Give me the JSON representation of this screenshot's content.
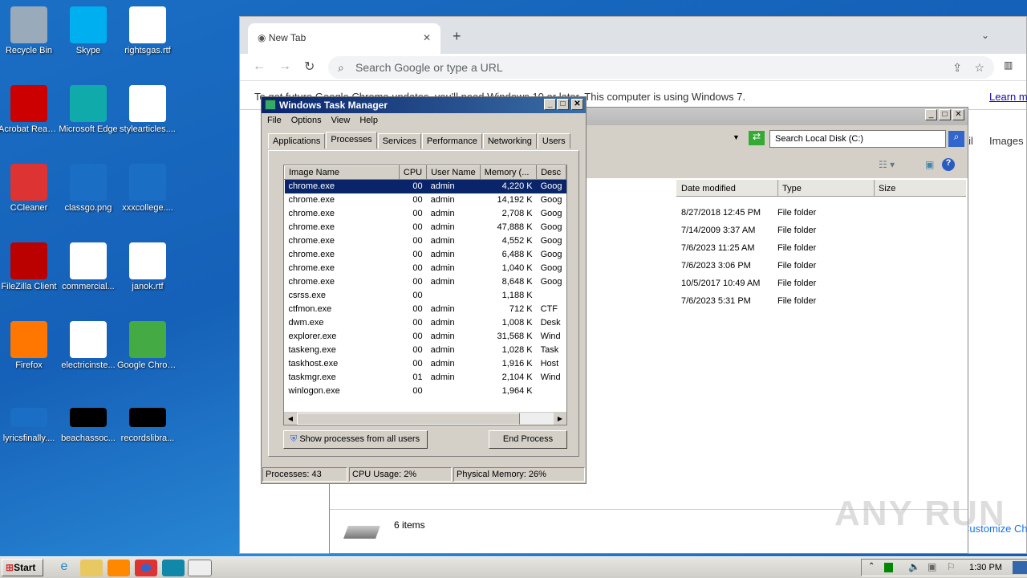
{
  "desktop": {
    "icons": [
      {
        "label": "Recycle Bin",
        "color": "#9ab"
      },
      {
        "label": "Skype",
        "color": "#00aff0"
      },
      {
        "label": "rightsgas.rtf",
        "color": "#fff"
      },
      {
        "label": "Acrobat Reader DC",
        "color": "#c00"
      },
      {
        "label": "Microsoft Edge",
        "color": "#1aa"
      },
      {
        "label": "stylearticles....",
        "color": "#fff"
      },
      {
        "label": "CCleaner",
        "color": "#d33"
      },
      {
        "label": "classgo.png",
        "color": "#1a6fc4"
      },
      {
        "label": "xxxcollege....",
        "color": "#1a6fc4"
      },
      {
        "label": "FileZilla Client",
        "color": "#b00"
      },
      {
        "label": "commercial...",
        "color": "#fff"
      },
      {
        "label": "janok.rtf",
        "color": "#fff"
      },
      {
        "label": "Firefox",
        "color": "#f70"
      },
      {
        "label": "electricinste...",
        "color": "#fff"
      },
      {
        "label": "Google Chrome",
        "color": "#4a4"
      },
      {
        "label": "lyricsfinally....",
        "color": "#1a6fc4"
      },
      {
        "label": "beachassoc...",
        "color": "#000"
      },
      {
        "label": "recordslibra...",
        "color": "#000"
      }
    ]
  },
  "chrome": {
    "tab_title": "New Tab",
    "omnibox_placeholder": "Search Google or type a URL",
    "infobar": "To get future Google Chrome updates, you'll need Windows 10 or later. This computer is using Windows 7.",
    "learn_more": "Learn more",
    "links": {
      "gmail": "Gmail",
      "images": "Images"
    },
    "customize": "Customize Chrome"
  },
  "explorer": {
    "search_placeholder": "Search Local Disk (C:)",
    "columns": [
      "Date modified",
      "Type",
      "Size"
    ],
    "rows": [
      [
        "8/27/2018 12:45 PM",
        "File folder"
      ],
      [
        "7/14/2009 3:37 AM",
        "File folder"
      ],
      [
        "7/6/2023 11:25 AM",
        "File folder"
      ],
      [
        "7/6/2023 3:06 PM",
        "File folder"
      ],
      [
        "10/5/2017 10:49 AM",
        "File folder"
      ],
      [
        "7/6/2023 5:31 PM",
        "File folder"
      ]
    ],
    "item_count": "6 items"
  },
  "taskmanager": {
    "title": "Windows Task Manager",
    "menu": [
      "File",
      "Options",
      "View",
      "Help"
    ],
    "tabs": [
      "Applications",
      "Processes",
      "Services",
      "Performance",
      "Networking",
      "Users"
    ],
    "active_tab": "Processes",
    "columns": [
      "Image Name",
      "CPU",
      "User Name",
      "Memory (...",
      "Desc"
    ],
    "processes": [
      [
        "chrome.exe",
        "00",
        "admin",
        "4,220 K",
        "Goog"
      ],
      [
        "chrome.exe",
        "00",
        "admin",
        "14,192 K",
        "Goog"
      ],
      [
        "chrome.exe",
        "00",
        "admin",
        "2,708 K",
        "Goog"
      ],
      [
        "chrome.exe",
        "00",
        "admin",
        "47,888 K",
        "Goog"
      ],
      [
        "chrome.exe",
        "00",
        "admin",
        "4,552 K",
        "Goog"
      ],
      [
        "chrome.exe",
        "00",
        "admin",
        "6,488 K",
        "Goog"
      ],
      [
        "chrome.exe",
        "00",
        "admin",
        "1,040 K",
        "Goog"
      ],
      [
        "chrome.exe",
        "00",
        "admin",
        "8,648 K",
        "Goog"
      ],
      [
        "csrss.exe",
        "00",
        "",
        "1,188 K",
        ""
      ],
      [
        "ctfmon.exe",
        "00",
        "admin",
        "712 K",
        "CTF"
      ],
      [
        "dwm.exe",
        "00",
        "admin",
        "1,008 K",
        "Desk"
      ],
      [
        "explorer.exe",
        "00",
        "admin",
        "31,568 K",
        "Wind"
      ],
      [
        "taskeng.exe",
        "00",
        "admin",
        "1,028 K",
        "Task"
      ],
      [
        "taskhost.exe",
        "00",
        "admin",
        "1,916 K",
        "Host"
      ],
      [
        "taskmgr.exe",
        "01",
        "admin",
        "2,104 K",
        "Wind"
      ],
      [
        "winlogon.exe",
        "00",
        "",
        "1,964 K",
        ""
      ]
    ],
    "show_all": "Show processes from all users",
    "end_process": "End Process",
    "status": {
      "processes": "Processes: 43",
      "cpu": "CPU Usage: 2%",
      "memory": "Physical Memory: 26%"
    }
  },
  "taskbar": {
    "start": "Start",
    "clock": "1:30 PM"
  },
  "watermark": "ANY RUN"
}
